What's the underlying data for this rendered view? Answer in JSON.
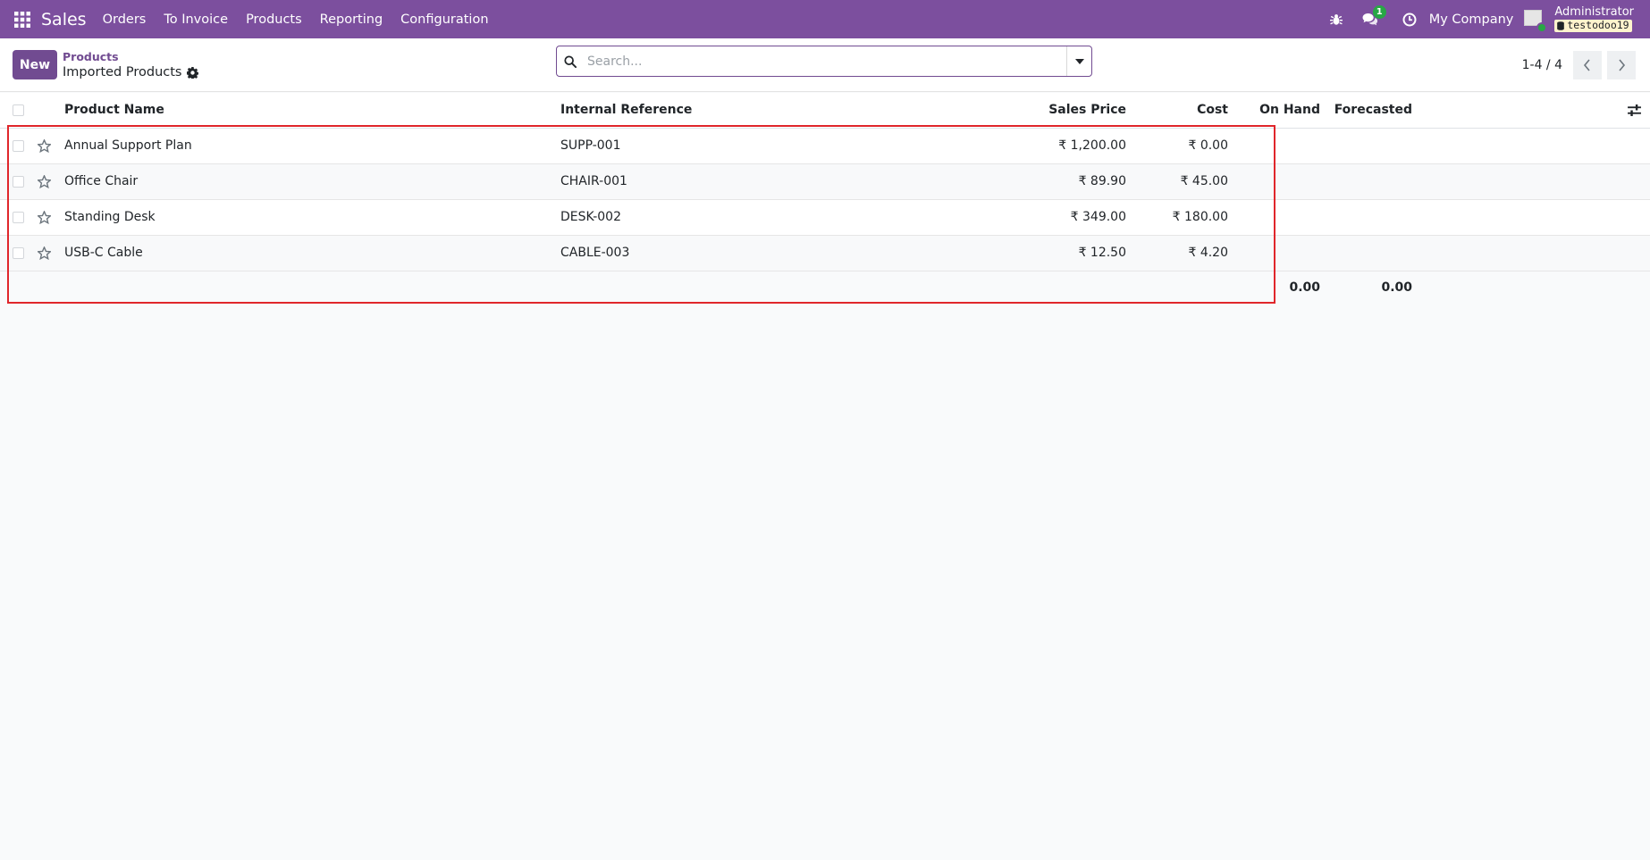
{
  "navbar": {
    "app_name": "Sales",
    "menu": [
      "Orders",
      "To Invoice",
      "Products",
      "Reporting",
      "Configuration"
    ],
    "messages_count": "1",
    "company": "My Company",
    "user_name": "Administrator",
    "database": "testodoo19",
    "icons": [
      "apps-grid-icon",
      "bug-icon",
      "chat-icon",
      "clock-icon",
      "database-icon"
    ]
  },
  "control_panel": {
    "new_button": "New",
    "breadcrumb_parent": "Products",
    "breadcrumb_current": "Imported Products",
    "search_placeholder": "Search...",
    "pager": "1-4 / 4"
  },
  "table": {
    "columns": [
      "Product Name",
      "Internal Reference",
      "Sales Price",
      "Cost",
      "On Hand",
      "Forecasted"
    ],
    "rows": [
      {
        "name": "Annual Support Plan",
        "ref": "SUPP-001",
        "price": "₹ 1,200.00",
        "cost": "₹ 0.00",
        "on_hand": "",
        "forecasted": ""
      },
      {
        "name": "Office Chair",
        "ref": "CHAIR-001",
        "price": "₹ 89.90",
        "cost": "₹ 45.00",
        "on_hand": "",
        "forecasted": ""
      },
      {
        "name": "Standing Desk",
        "ref": "DESK-002",
        "price": "₹ 349.00",
        "cost": "₹ 180.00",
        "on_hand": "",
        "forecasted": ""
      },
      {
        "name": "USB-C Cable",
        "ref": "CABLE-003",
        "price": "₹ 12.50",
        "cost": "₹ 4.20",
        "on_hand": "",
        "forecasted": ""
      }
    ],
    "totals": {
      "on_hand": "0.00",
      "forecasted": "0.00"
    }
  },
  "colors": {
    "navbar": "#7c4f9e",
    "primary": "#714b91",
    "highlight_border": "#e0262b",
    "badge": "#28a745"
  }
}
